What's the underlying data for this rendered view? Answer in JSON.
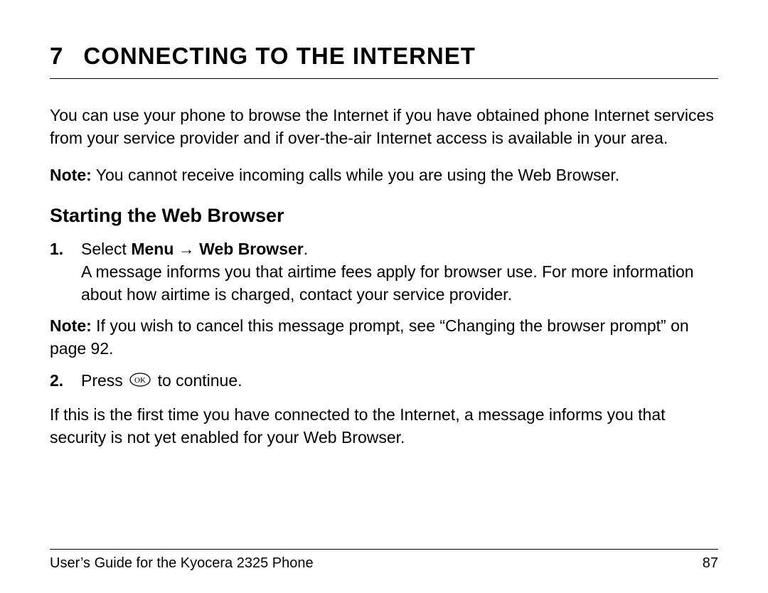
{
  "chapter": {
    "number": "7",
    "title": "CONNECTING TO THE INTERNET"
  },
  "intro": "You can use your phone to browse the Internet if you have obtained phone Internet services from your service provider and if over-the-air Internet access is available in your area.",
  "note1": {
    "label": "Note:",
    "text": " You cannot receive incoming calls while you are using the Web Browser."
  },
  "section_heading": "Starting the Web Browser",
  "step1": {
    "number": "1.",
    "prefix": "Select ",
    "menu": "Menu",
    "arrow": " → ",
    "browser": "Web Browser",
    "period": ".",
    "body": "A message informs you that airtime fees apply for browser use. For more information about how airtime is charged, contact your service provider."
  },
  "note2": {
    "label": "Note:",
    "text": " If you wish to cancel this message prompt, see “Changing the browser prompt” on page 92."
  },
  "step2": {
    "number": "2.",
    "prefix": "Press ",
    "suffix": " to continue."
  },
  "post": "If this is the first time you have connected to the Internet, a message informs you that security is not yet enabled for your Web Browser.",
  "footer": {
    "left": "User’s Guide for the Kyocera 2325 Phone",
    "right": "87"
  }
}
